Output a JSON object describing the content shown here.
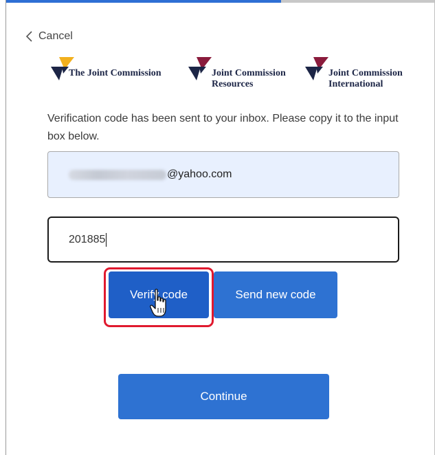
{
  "header": {
    "cancel_label": "Cancel",
    "back_icon": "chevron-left-icon"
  },
  "logos": [
    {
      "line1": "The Joint Commission",
      "line2": "",
      "color_accent": "#f2b01e"
    },
    {
      "line1": "Joint Commission",
      "line2": "Resources",
      "color_accent": "#8a1b3c"
    },
    {
      "line1": "Joint Commission",
      "line2": "International",
      "color_accent": "#8a1b3c"
    }
  ],
  "form": {
    "instructions": "Verification code has been sent to your inbox. Please copy it to the input box below.",
    "email_value": "@yahoo.com",
    "code_value": "201885",
    "verify_label": "Verify code",
    "send_new_label": "Send new code",
    "continue_label": "Continue"
  },
  "colors": {
    "primary_button": "#2e72d2",
    "verify_button": "#1f5fc7",
    "highlight": "#e0192e",
    "email_field_bg": "#e8f0fe",
    "logo_navy": "#1c2546"
  },
  "cursor_icon": "hand-pointer-icon"
}
